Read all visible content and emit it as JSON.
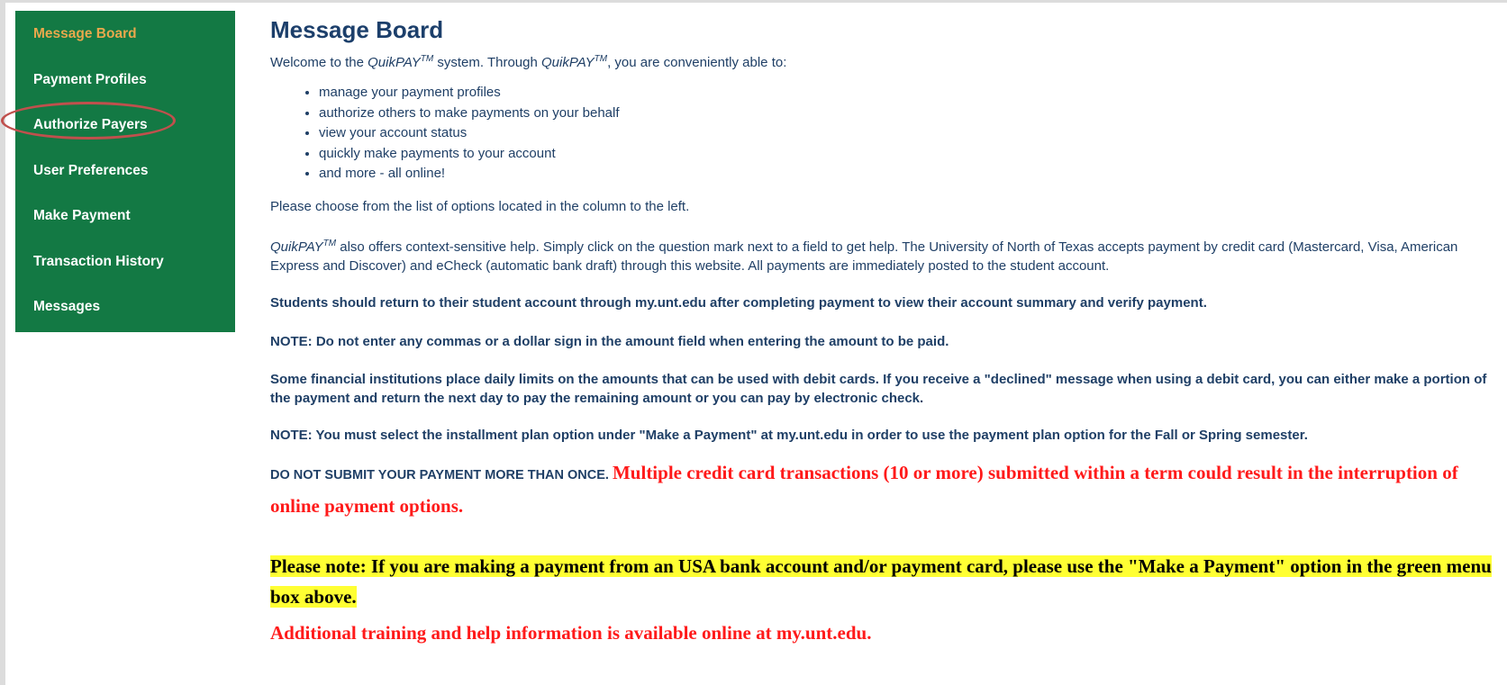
{
  "sidebar": {
    "items": [
      {
        "label": "Message Board",
        "active": true
      },
      {
        "label": "Payment Profiles"
      },
      {
        "label": "Authorize Payers"
      },
      {
        "label": "User Preferences"
      },
      {
        "label": "Make Payment"
      },
      {
        "label": "Transaction History"
      },
      {
        "label": "Messages"
      }
    ]
  },
  "main": {
    "title": "Message Board",
    "welcome_prefix": "Welcome to the ",
    "brand": "QuikPAY",
    "tm": "TM",
    "welcome_middle": " system. Through ",
    "welcome_suffix": ", you are conveniently able to:",
    "bullets": [
      "manage your payment profiles",
      "authorize others to make payments on your behalf",
      "view your account status",
      "quickly make payments to your account",
      "and more - all online!"
    ],
    "choose_text": "Please choose from the list of options located in the column to the left.",
    "help_text": " also offers context-sensitive help. Simply click on the question mark next to a field to get help. The University of North of Texas accepts payment by credit card (Mastercard, Visa, American Express and Discover) and eCheck (automatic bank draft) through this website. All payments are immediately posted to the student account.",
    "students_note": "Students should return to their student account through my.unt.edu after completing payment to view their account summary and verify payment.",
    "commas_note": "NOTE: Do not enter any commas or a dollar sign in the amount field when entering the amount to be paid.",
    "debit_note": "Some financial institutions place daily limits on the amounts that can be used with debit cards. If you receive a \"declined\" message when using a debit card, you can either make a portion of the payment and return the next day to pay the remaining amount or you can pay by electronic check.",
    "installment_note": "NOTE: You must select the installment plan option under \"Make a Payment\" at my.unt.edu in order to use the payment plan option for the Fall or Spring semester.",
    "once_note": "DO NOT SUBMIT YOUR PAYMENT MORE THAN ONCE. ",
    "multiple_warning": "Multiple credit card transactions (10 or more) submitted within a term could result in the interruption of online payment options.",
    "usa_note": "Please note: If you are making a payment from an USA bank account and/or payment card, please use the \"Make a Payment\" option in the green menu box above.",
    "training_note": "Additional training and help information is available online at my.unt.edu."
  },
  "colors": {
    "sidebar_bg": "#137944",
    "active_link": "#e9a84c",
    "text_blue": "#1f3f66",
    "warning_red": "#ff1a1a",
    "highlight_yellow": "#ffff33",
    "annotation_ring": "#c0504d"
  }
}
